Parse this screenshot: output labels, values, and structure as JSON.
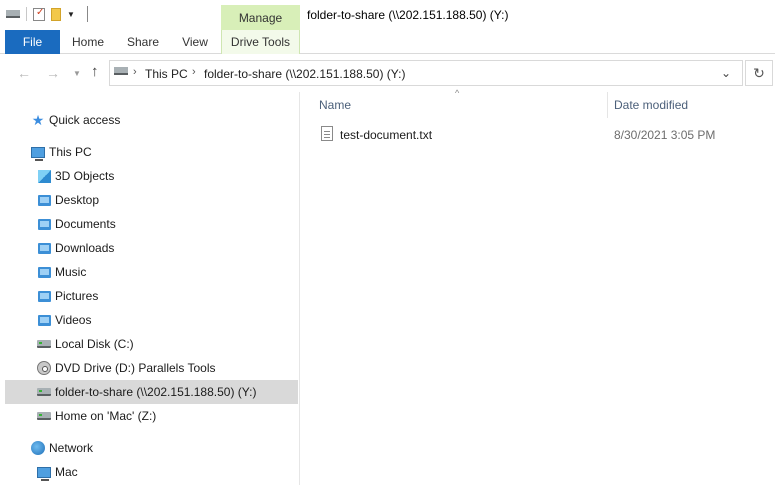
{
  "window": {
    "title": "folder-to-share (\\\\202.151.188.50) (Y:)"
  },
  "quick_access_toolbar": {
    "icons": [
      "drive-icon",
      "properties-icon",
      "new-folder-icon",
      "customize-caret-icon"
    ]
  },
  "ribbon": {
    "context_group_label": "Manage",
    "tabs": [
      "File",
      "Home",
      "Share",
      "View",
      "Drive Tools"
    ]
  },
  "address": {
    "crumbs": [
      "This PC",
      "folder-to-share (\\\\202.151.188.50) (Y:)"
    ]
  },
  "navigation": {
    "quick_access": "Quick access",
    "this_pc": "This PC",
    "items": [
      "3D Objects",
      "Desktop",
      "Documents",
      "Downloads",
      "Music",
      "Pictures",
      "Videos",
      "Local Disk (C:)",
      "DVD Drive (D:) Parallels Tools",
      "folder-to-share (\\\\202.151.188.50) (Y:)",
      "Home on 'Mac' (Z:)"
    ],
    "selected": "folder-to-share (\\\\202.151.188.50) (Y:)",
    "network": "Network",
    "network_items": [
      "Mac"
    ]
  },
  "columns": {
    "name": "Name",
    "date_modified": "Date modified"
  },
  "files": [
    {
      "name": "test-document.txt",
      "date_modified": "8/30/2021 3:05 PM"
    }
  ],
  "colors": {
    "file_tab": "#1a6bbf",
    "context_tab": "#d8efb8",
    "selection": "#d9d9d9",
    "column_header": "#4c607a"
  }
}
